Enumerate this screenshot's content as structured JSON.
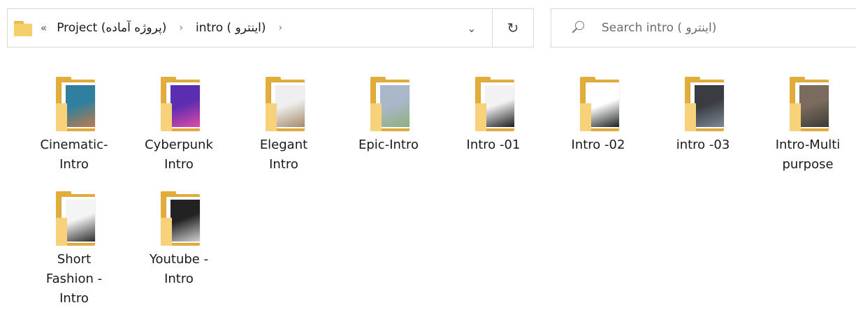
{
  "addressbar": {
    "overflow": "«",
    "crumbs": [
      "Project (پروژه آماده)",
      "intro ( اینترو)"
    ],
    "separator": "›",
    "dropdown_icon": "chevron-down-icon",
    "refresh_icon": "refresh-icon",
    "dropdown_glyph": "⌄",
    "refresh_glyph": "↻"
  },
  "search": {
    "placeholder": "Search intro ( اینترو)"
  },
  "items": [
    {
      "lines": [
        "Cinematic-",
        "Intro"
      ],
      "thumb": [
        "#2f7fa0",
        "#c07a4a"
      ]
    },
    {
      "lines": [
        "Cyberpunk",
        "Intro"
      ],
      "thumb": [
        "#5b2db0",
        "#e04aa8"
      ]
    },
    {
      "lines": [
        "Elegant",
        "Intro"
      ],
      "thumb": [
        "#efefef",
        "#a48a6a"
      ]
    },
    {
      "lines": [
        "Epic-Intro"
      ],
      "thumb": [
        "#a9b7c8",
        "#8fb07f"
      ]
    },
    {
      "lines": [
        "Intro -01"
      ],
      "thumb": [
        "#f2f2f2",
        "#1b1b1b"
      ]
    },
    {
      "lines": [
        "Intro -02"
      ],
      "thumb": [
        "#ffffff",
        "#1d1f20"
      ]
    },
    {
      "lines": [
        "intro -03"
      ],
      "thumb": [
        "#3a3c41",
        "#7c8a96"
      ]
    },
    {
      "lines": [
        "Intro-Multi",
        "purpose"
      ],
      "thumb": [
        "#7a6b5e",
        "#3d3a36"
      ]
    },
    {
      "lines": [
        "Short",
        "Fashion -",
        "Intro"
      ],
      "thumb": [
        "#f4f4f4",
        "#2b2b2b"
      ]
    },
    {
      "lines": [
        "Youtube -",
        "Intro"
      ],
      "thumb": [
        "#222222",
        "#d0d0d0"
      ]
    }
  ]
}
